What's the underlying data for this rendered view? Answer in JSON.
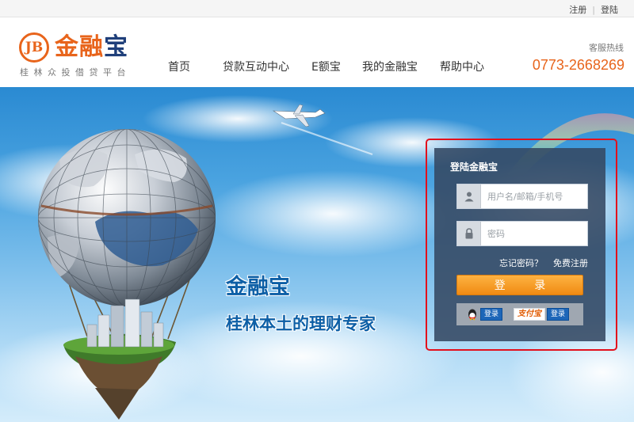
{
  "topbar": {
    "register": "注册",
    "login": "登陆"
  },
  "logo": {
    "mark": "JB",
    "name_part1": "金融",
    "name_part2": "宝",
    "tagline": "桂林众投借贷平台"
  },
  "nav": {
    "items": [
      "首页",
      "贷款互动中心",
      "E额宝",
      "我的金融宝",
      "帮助中心"
    ]
  },
  "hotline": {
    "label": "客服热线",
    "number": "0773-2668269"
  },
  "banner": {
    "title": "金融宝",
    "subtitle": "桂林本土的理财专家"
  },
  "login": {
    "title": "登陆金融宝",
    "username_placeholder": "用户名/邮箱/手机号",
    "password_placeholder": "密码",
    "forgot": "忘记密码？",
    "register": "免费注册",
    "submit": "登 录",
    "qq_login": "登录",
    "alipay_logo": "支付宝",
    "alipay_login": "登录"
  },
  "colors": {
    "brand_orange": "#e8641b",
    "brand_blue": "#1f3f7a",
    "login_border": "#e3101c",
    "button_orange": "#f39a1d"
  }
}
